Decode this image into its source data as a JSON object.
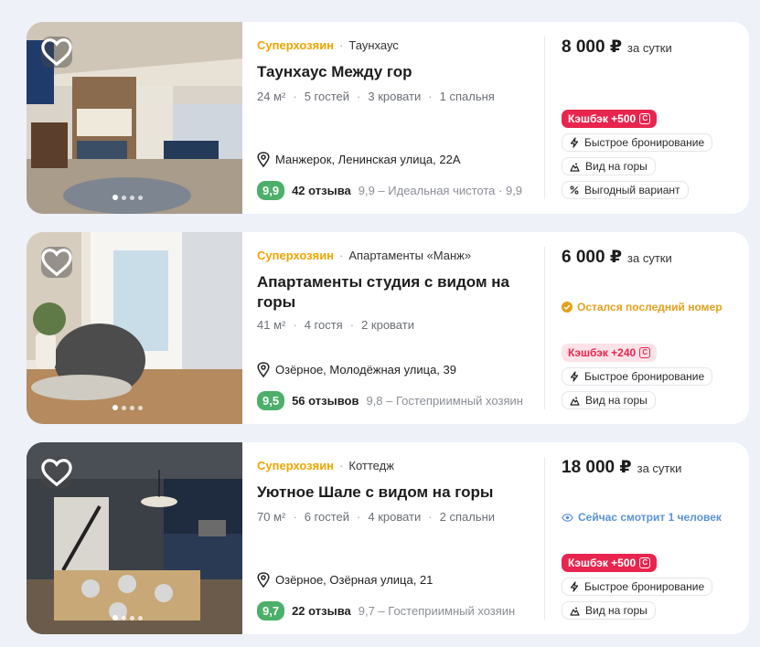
{
  "listings": [
    {
      "host_badge": "Суперхозяин",
      "type": "Таунхаус",
      "title": "Таунхаус Между гор",
      "specs": [
        "24 м²",
        "5 гостей",
        "3 кровати",
        "1 спальня"
      ],
      "address": "Манжерок, Ленинская улица, 22А",
      "score": "9,9",
      "reviews": "42 отзыва",
      "review_detail": "9,9 – Идеальная чистота · 9,9",
      "price": "8 000 ₽",
      "per": "за сутки",
      "notice": "",
      "cashback": "Кэшбэк +500",
      "cashback_style": "strong",
      "tags": [
        {
          "icon": "lightning-icon",
          "label": "Быстрое бронирование"
        },
        {
          "icon": "mountain-icon",
          "label": "Вид на горы"
        },
        {
          "icon": "percent-icon",
          "label": "Выгодный вариант"
        }
      ]
    },
    {
      "host_badge": "Суперхозяин",
      "type": "Апартаменты «Манж»",
      "title": "Апартаменты студия с видом на горы",
      "specs": [
        "41 м²",
        "4 гостя",
        "2 кровати"
      ],
      "address": "Озёрное, Молодёжная улица, 39",
      "score": "9,5",
      "reviews": "56 отзывов",
      "review_detail": "9,8 – Гостеприимный хозяин",
      "price": "6 000 ₽",
      "per": "за сутки",
      "notice": "Остался последний номер",
      "cashback": "Кэшбэк +240",
      "cashback_style": "soft",
      "tags": [
        {
          "icon": "lightning-icon",
          "label": "Быстрое бронирование"
        },
        {
          "icon": "mountain-icon",
          "label": "Вид на горы"
        }
      ]
    },
    {
      "host_badge": "Суперхозяин",
      "type": "Коттедж",
      "title": "Уютное Шале с видом на горы",
      "specs": [
        "70 м²",
        "6 гостей",
        "4 кровати",
        "2 спальни"
      ],
      "address": "Озёрное, Озёрная улица, 21",
      "score": "9,7",
      "reviews": "22 отзыва",
      "review_detail": "9,7 – Гостеприимный хозяин",
      "price": "18 000 ₽",
      "per": "за сутки",
      "notice": "Сейчас смотрит 1 человек",
      "cashback": "Кэшбэк +500",
      "cashback_style": "strong",
      "tags": [
        {
          "icon": "lightning-icon",
          "label": "Быстрое бронирование"
        },
        {
          "icon": "mountain-icon",
          "label": "Вид на горы"
        }
      ]
    }
  ],
  "colors": {
    "superhost": "#f0a500",
    "score_bg": "#4caf6a",
    "cashback_strong": "#e8254f",
    "cashback_soft_bg": "#fde3e8",
    "notice_last": "#e3a11b",
    "notice_watch": "#5a93d6"
  }
}
